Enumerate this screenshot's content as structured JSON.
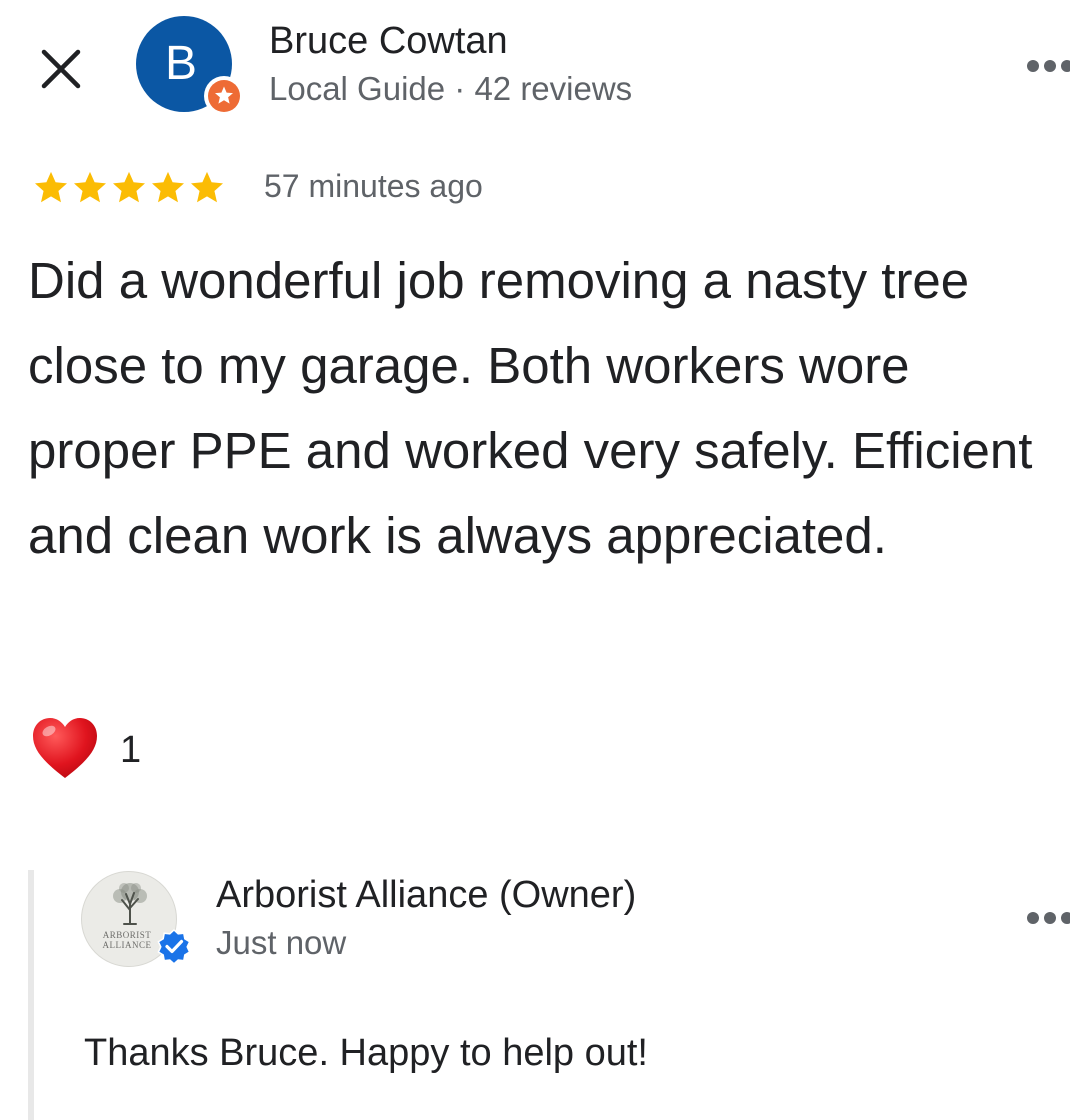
{
  "icons": {
    "close": "close-icon",
    "more": "more-horiz-icon",
    "local_guide": "local-guide-star-icon",
    "star": "star-icon",
    "heart": "heart-icon",
    "verified": "verified-check-icon"
  },
  "colors": {
    "avatar_bg": "#0b57a4",
    "local_guide_badge": "#ee6b35",
    "star": "#fbbc04",
    "heart": "#e0141e",
    "verified": "#1a73e8",
    "secondary_text": "#5f6368",
    "primary_text": "#202124"
  },
  "review": {
    "author": {
      "initial": "B",
      "name": "Bruce Cowtan",
      "meta": "Local Guide · 42 reviews"
    },
    "rating": 5,
    "rating_max": 5,
    "time": "57 minutes ago",
    "text": "Did a wonderful job removing a nasty tree close to my garage. Both workers wore proper PPE and worked very safely. Efficient and clean work is always appreciated.",
    "reactions": {
      "count": "1"
    }
  },
  "owner_reply": {
    "name": "Arborist Alliance (Owner)",
    "time": "Just now",
    "logo_text": "ARBORIST ALLIANCE",
    "text": "Thanks Bruce. Happy to help out!"
  }
}
